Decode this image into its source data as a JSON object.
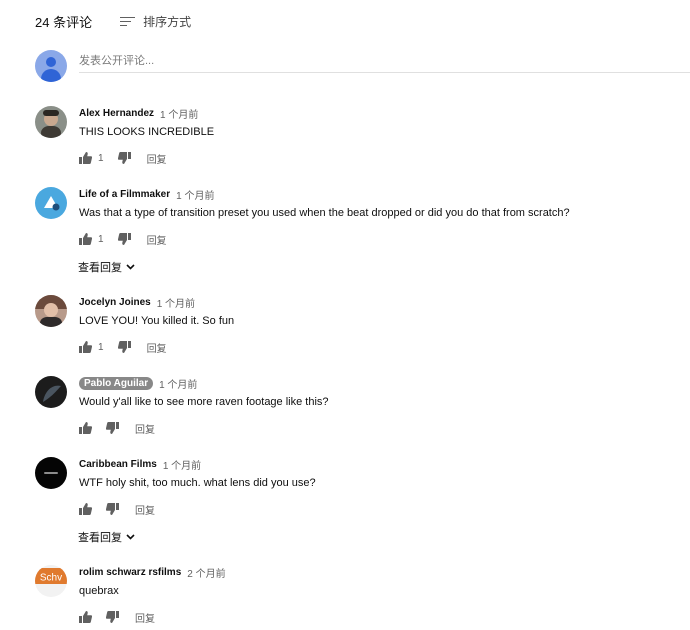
{
  "header": {
    "comment_count": "24 条评论",
    "sort_label": "排序方式"
  },
  "add_comment": {
    "placeholder": "发表公开评论..."
  },
  "comments": [
    {
      "author": "Alex Hernandez",
      "time": "1 个月前",
      "text": "THIS LOOKS INCREDIBLE",
      "likes": "1",
      "reply_label": "回复",
      "view_replies": ""
    },
    {
      "author": "Life of a Filmmaker",
      "time": "1 个月前",
      "text": "Was that a type of transition preset you used when the beat dropped or did you do that from scratch?",
      "likes": "1",
      "reply_label": "回复",
      "view_replies": "查看回复"
    },
    {
      "author": "Jocelyn Joines",
      "time": "1 个月前",
      "text": "LOVE YOU! You killed it. So fun",
      "likes": "1",
      "reply_label": "回复",
      "view_replies": ""
    },
    {
      "author": "Pablo Aguilar",
      "time": "1 个月前",
      "text": "Would y'all like to see more raven footage like this?",
      "likes": "",
      "reply_label": "回复",
      "view_replies": ""
    },
    {
      "author": "Caribbean Films",
      "time": "1 个月前",
      "text": "WTF holy shit, too much. what lens did you use?",
      "likes": "",
      "reply_label": "回复",
      "view_replies": "查看回复"
    },
    {
      "author": "rolim schwarz rsfilms",
      "time": "2 个月前",
      "text": "quebrax",
      "likes": "",
      "reply_label": "回复",
      "view_replies": "",
      "avatar_text": "Schv"
    }
  ],
  "colors": {
    "text": "#0f0f0f",
    "secondary": "#606060",
    "author_badge_bg": "#888888",
    "default_avatar": "#8aa8e8"
  },
  "icons": {
    "like": "thumbs-up-icon",
    "dislike": "thumbs-down-icon",
    "sort": "sort-icon",
    "expand": "chevron-down-icon"
  }
}
